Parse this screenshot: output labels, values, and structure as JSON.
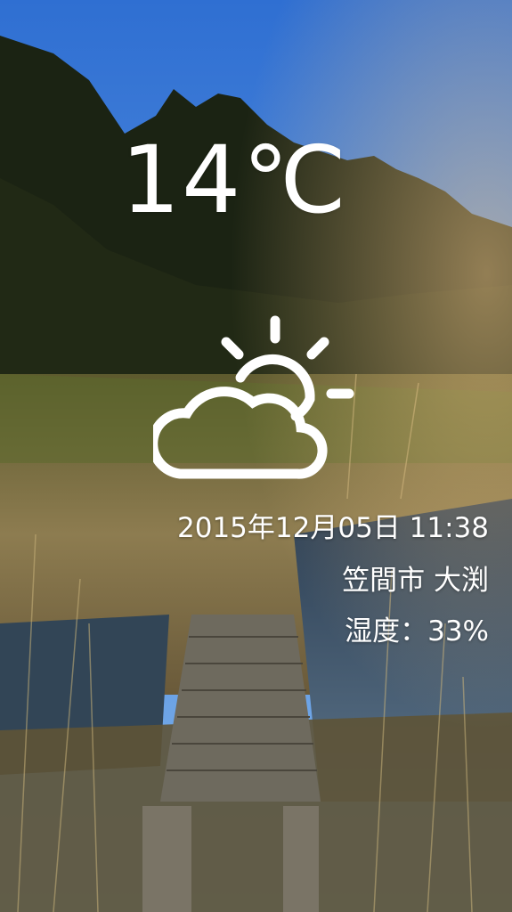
{
  "weather": {
    "temperature": "14℃",
    "condition_icon": "partly-cloudy-icon",
    "datetime": "2015年12月05日 11:38",
    "location": "笠間市 大渕",
    "humidity": "湿度：33%"
  },
  "colors": {
    "text": "#ffffff",
    "sky": "#3f7fd6",
    "forest": "#1c2414",
    "grass": "#8a7a48",
    "water": "#3a5a78",
    "boardwalk": "#6e6a5e"
  }
}
